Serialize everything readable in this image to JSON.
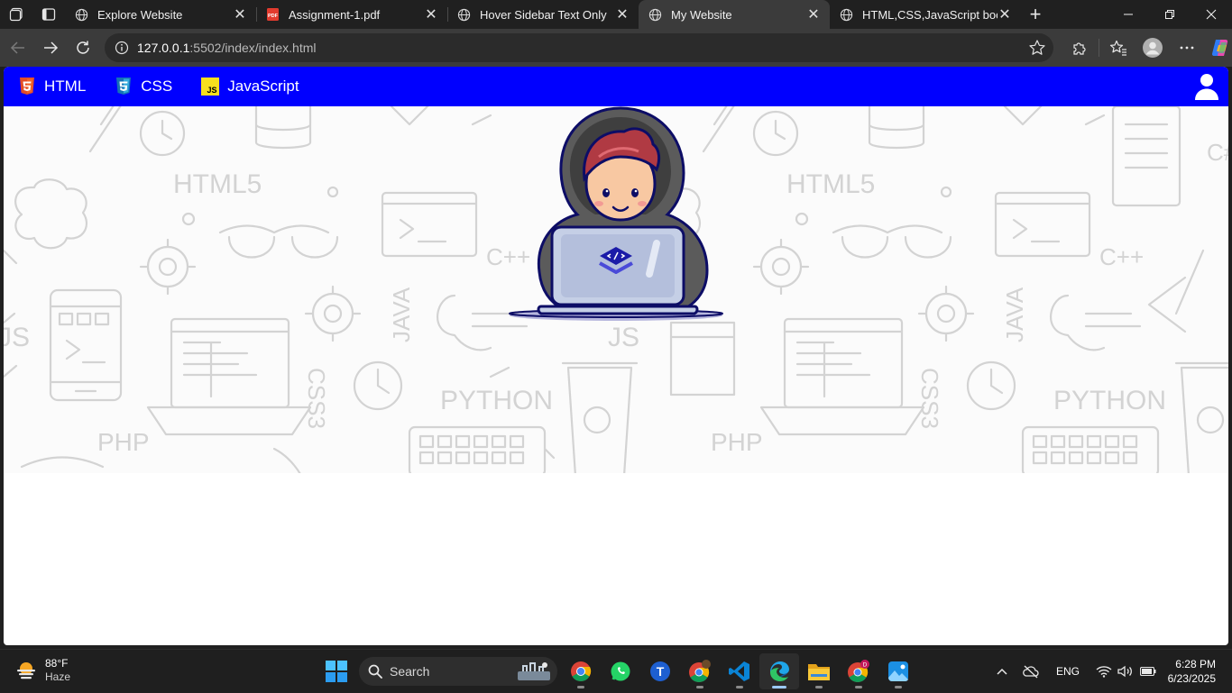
{
  "browser": {
    "tabs": [
      {
        "title": "Explore Website",
        "icon": "globe-icon",
        "active": false
      },
      {
        "title": "Assignment-1.pdf",
        "icon": "pdf-icon",
        "active": false
      },
      {
        "title": "Hover Sidebar Text Only",
        "icon": "globe-icon",
        "active": false
      },
      {
        "title": "My Website",
        "icon": "globe-icon",
        "active": true
      },
      {
        "title": "HTML,CSS,JavaScript book",
        "icon": "globe-icon",
        "active": false
      }
    ],
    "address": {
      "host": "127.0.0.1",
      "path": ":5502/index/index.html"
    }
  },
  "site": {
    "nav": [
      {
        "label": "HTML",
        "icon": "html5-logo-icon"
      },
      {
        "label": "CSS",
        "icon": "css3-logo-icon"
      },
      {
        "label": "JavaScript",
        "icon": "javascript-logo-icon"
      }
    ],
    "hero_words": [
      "HTML5",
      "HTML5",
      "C++",
      "C++",
      "JAVA",
      "JAVA",
      "PHP",
      "PHP",
      "PYTHON",
      "PYTHON",
      "JS",
      "CSS3",
      "CSS3",
      "JS",
      "C#"
    ],
    "colors": {
      "nav_background": "#0000ff",
      "nav_text": "#ffffff"
    }
  },
  "taskbar": {
    "weather": {
      "temp": "88°F",
      "desc": "Haze"
    },
    "search_label": "Search",
    "apps": [
      "chrome-icon",
      "whatsapp-icon",
      "app-t-icon",
      "chrome-profile-icon",
      "vscode-icon",
      "edge-icon",
      "file-explorer-icon",
      "chrome-profile-d-icon",
      "photos-icon"
    ],
    "tray": {
      "language": "ENG"
    },
    "clock": {
      "time": "6:28 PM",
      "date": "6/23/2025"
    }
  }
}
